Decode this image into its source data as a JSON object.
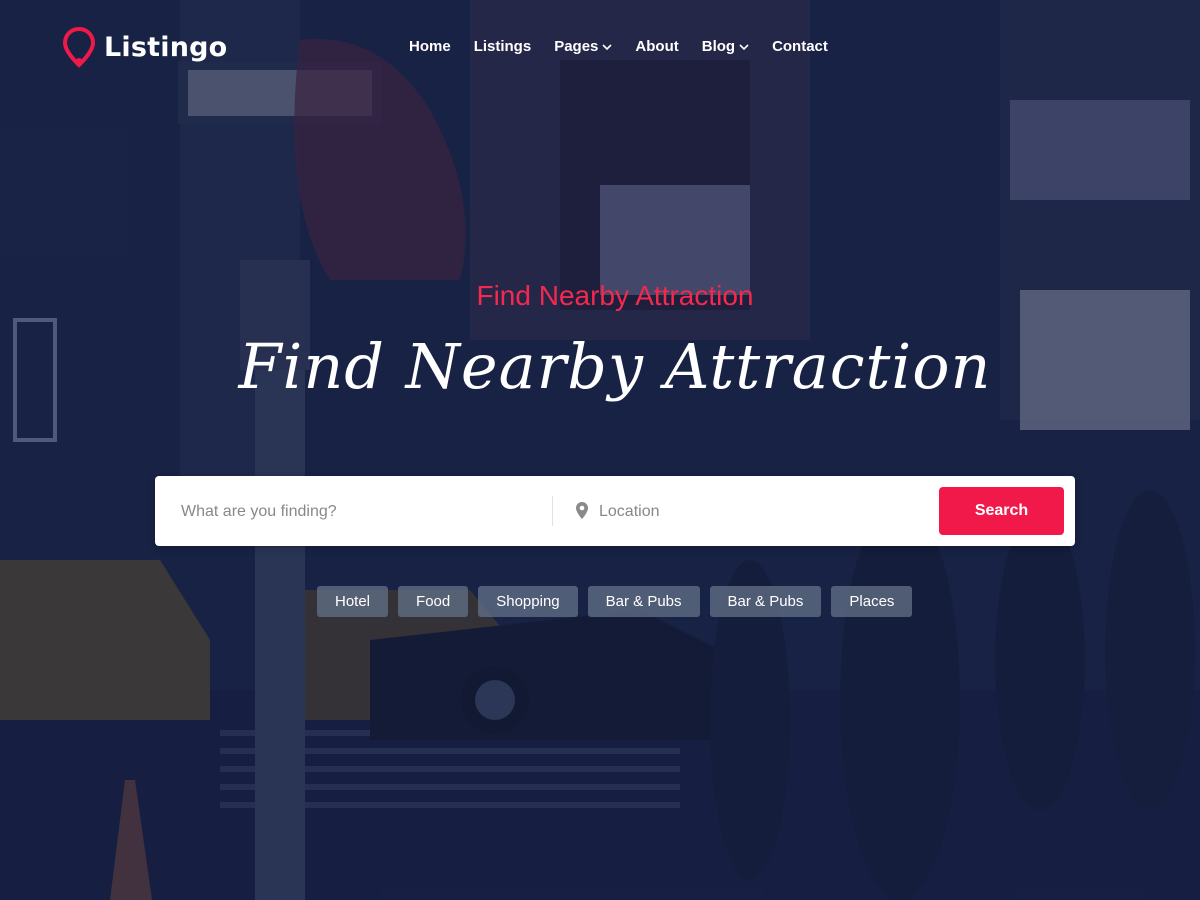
{
  "brand": {
    "name": "Listingo",
    "accent_color": "#f0194a",
    "logo_icon": "map-pin-icon"
  },
  "nav": {
    "items": [
      {
        "label": "Home",
        "has_dropdown": false
      },
      {
        "label": "Listings",
        "has_dropdown": false
      },
      {
        "label": "Pages",
        "has_dropdown": true
      },
      {
        "label": "About",
        "has_dropdown": false
      },
      {
        "label": "Blog",
        "has_dropdown": true
      },
      {
        "label": "Contact",
        "has_dropdown": false
      }
    ]
  },
  "hero": {
    "subtitle": "Find Nearby Attraction",
    "title": "Find Nearby Attraction",
    "subtitle_color": "#f5284e"
  },
  "search": {
    "keyword_placeholder": "What are you finding?",
    "location_placeholder": "Location",
    "location_icon": "map-pin-icon",
    "button_label": "Search"
  },
  "categories": [
    "Hotel",
    "Food",
    "Shopping",
    "Bar & Pubs",
    "Bar & Pubs",
    "Places"
  ]
}
